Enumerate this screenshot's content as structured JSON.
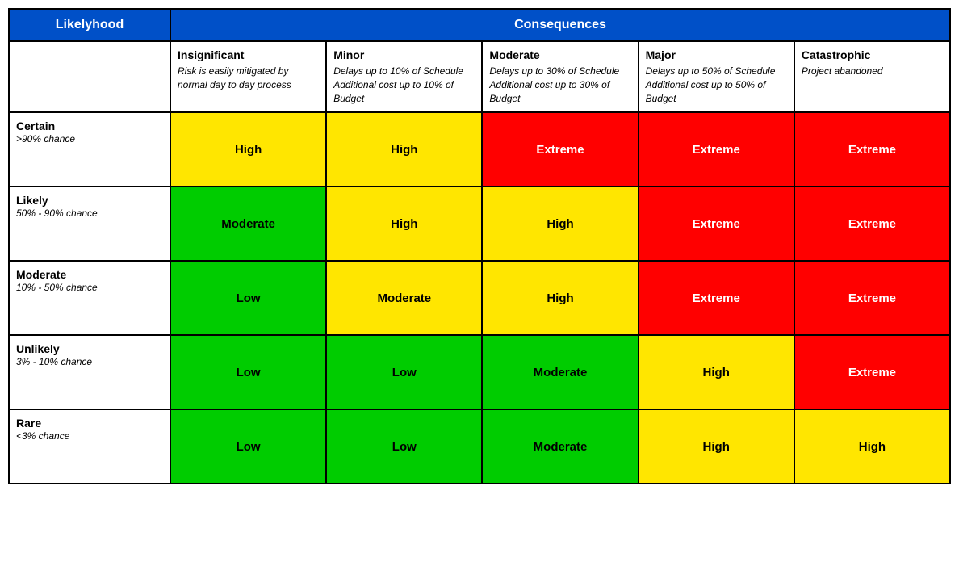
{
  "headers": {
    "likelihood": "Likelyhood",
    "consequences": "Consequences"
  },
  "col_headers": [
    {
      "title": "Insignificant",
      "desc": "Risk is easily mitigated by normal day to day process"
    },
    {
      "title": "Minor",
      "desc": "Delays up to 10% of Schedule Additional cost up to 10% of Budget"
    },
    {
      "title": "Moderate",
      "desc": "Delays up to 30% of Schedule Additional cost up to 30% of Budget"
    },
    {
      "title": "Major",
      "desc": "Delays up to 50% of Schedule Additional cost up to 50% of Budget"
    },
    {
      "title": "Catastrophic",
      "desc": "Project abandoned"
    }
  ],
  "rows": [
    {
      "title": "Certain",
      "subtitle": ">90% chance",
      "cells": [
        {
          "label": "High",
          "color": "yellow"
        },
        {
          "label": "High",
          "color": "yellow"
        },
        {
          "label": "Extreme",
          "color": "red"
        },
        {
          "label": "Extreme",
          "color": "red"
        },
        {
          "label": "Extreme",
          "color": "red"
        }
      ]
    },
    {
      "title": "Likely",
      "subtitle": "50% - 90% chance",
      "cells": [
        {
          "label": "Moderate",
          "color": "green"
        },
        {
          "label": "High",
          "color": "yellow"
        },
        {
          "label": "High",
          "color": "yellow"
        },
        {
          "label": "Extreme",
          "color": "red"
        },
        {
          "label": "Extreme",
          "color": "red"
        }
      ]
    },
    {
      "title": "Moderate",
      "subtitle": "10% - 50% chance",
      "cells": [
        {
          "label": "Low",
          "color": "green"
        },
        {
          "label": "Moderate",
          "color": "yellow"
        },
        {
          "label": "High",
          "color": "yellow"
        },
        {
          "label": "Extreme",
          "color": "red"
        },
        {
          "label": "Extreme",
          "color": "red"
        }
      ]
    },
    {
      "title": "Unlikely",
      "subtitle": "3% - 10% chance",
      "cells": [
        {
          "label": "Low",
          "color": "green"
        },
        {
          "label": "Low",
          "color": "green"
        },
        {
          "label": "Moderate",
          "color": "green"
        },
        {
          "label": "High",
          "color": "yellow"
        },
        {
          "label": "Extreme",
          "color": "red"
        }
      ]
    },
    {
      "title": "Rare",
      "subtitle": "<3% chance",
      "cells": [
        {
          "label": "Low",
          "color": "green"
        },
        {
          "label": "Low",
          "color": "green"
        },
        {
          "label": "Moderate",
          "color": "green"
        },
        {
          "label": "High",
          "color": "yellow"
        },
        {
          "label": "High",
          "color": "yellow"
        }
      ]
    }
  ]
}
